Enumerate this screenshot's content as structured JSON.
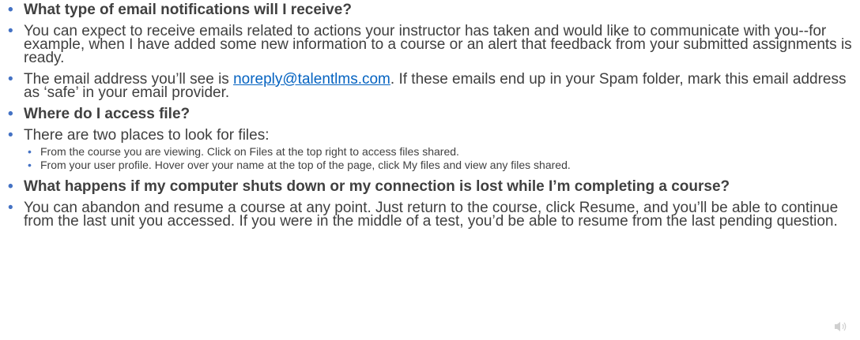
{
  "faq": {
    "q1": "What type of email notifications will I receive?",
    "a1": " You can expect to receive emails related to actions your instructor has taken and would like to communicate with you--for example, when I have added some new information to a course or an alert that feedback from your submitted assignments is ready.",
    "a2_before": "The email address you’ll see is ",
    "a2_email": "noreply@talentlms.com",
    "a2_after": ". If these emails end up in your Spam folder, mark this email address as ‘safe’ in your email provider.",
    "q2": "Where do I access file?",
    "a3": "There are two places to look for files:",
    "a3_sub": [
      "From the course you are viewing. Click on Files at the top right to access files shared.",
      "From your user profile. Hover over your name at the top of the page, click My files and view any files shared."
    ],
    "q3": "What happens if my computer shuts down or my connection is lost while I’m completing a course?",
    "a4": "You can abandon and resume a course at any point. Just return to the course, click Resume, and you’ll be able to continue from the last unit you accessed. If you were in the middle of a test, you’d be able to resume from the last pending question."
  },
  "icons": {
    "audio": "speaker-icon"
  }
}
